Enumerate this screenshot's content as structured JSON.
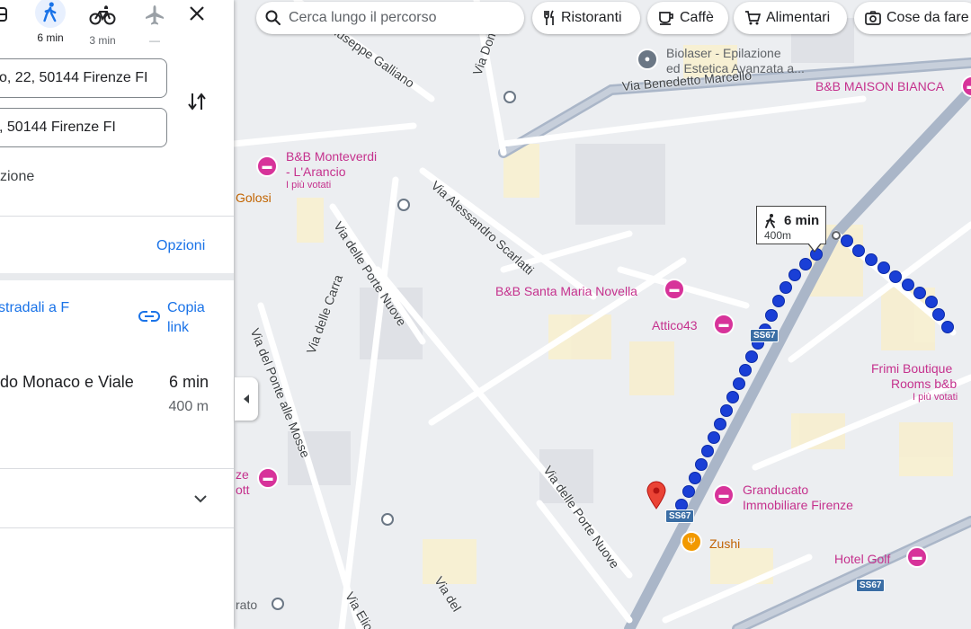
{
  "travel_modes": [
    {
      "name": "transit",
      "label": ""
    },
    {
      "name": "walk",
      "label": "6 min"
    },
    {
      "name": "bike",
      "label": "3 min"
    },
    {
      "name": "flight",
      "label": "—"
    }
  ],
  "directions": {
    "origin": "o, 22, 50144 Firenze FI",
    "destination": ", 50144 Firenze FI",
    "options_note": "zione"
  },
  "panel": {
    "options_link": "Opzioni",
    "send_text": "stradali a F",
    "copy_link": "Copia link",
    "route_name": "do Monaco e Viale",
    "route_time": "6 min",
    "route_distance": "400 m"
  },
  "search": {
    "placeholder": "Cerca lungo il percorso"
  },
  "chips": [
    "Ristoranti",
    "Caffè",
    "Alimentari",
    "Cose da fare"
  ],
  "tooltip": {
    "time": "6 min",
    "distance": "400m"
  },
  "pois": {
    "biolaser_1": "Biolaser - Epilazione",
    "biolaser_2": "ed Estetica Avanzata a...",
    "maison": "B&B MAISON BIANCA",
    "monteverdi_1": "B&B Monteverdi",
    "monteverdi_2": "- L'Arancio",
    "monteverdi_sub": "I più votati",
    "golosi": "Golosi",
    "santa_maria": "B&B Santa Maria Novella",
    "attico": "Attico43",
    "frimi_1": "Frimi Boutique",
    "frimi_2": "Rooms b&b",
    "frimi_sub": "I più votati",
    "granducato_1": "Granducato",
    "granducato_2": "Immobiliare Firenze",
    "zushi": "Zushi",
    "hotel_golf": "Hotel Golf",
    "ze_1": "ze",
    "ze_2": "ott",
    "rato": "rato"
  },
  "streets": {
    "galliano": "Giuseppe Galliano",
    "marcello": "Via Benedetto Marcello",
    "dom": "Via Dom",
    "scarlatti": "Via Alessandro Scarlatti",
    "porte_nuove_1": "Via delle Porte Nuove",
    "porte_nuove_2": "Via delle Porte Nuove",
    "carra": "Via delle Carra",
    "ponte_mosse": "Via del Ponte alle Mosse",
    "elio": "Via Elio G",
    "del": "Via del"
  },
  "road_shields": [
    "SS67",
    "SS67",
    "SS67"
  ],
  "colors": {
    "route": "#1a3fd6",
    "poi": "#c5318d",
    "accent": "#1a73e8"
  }
}
